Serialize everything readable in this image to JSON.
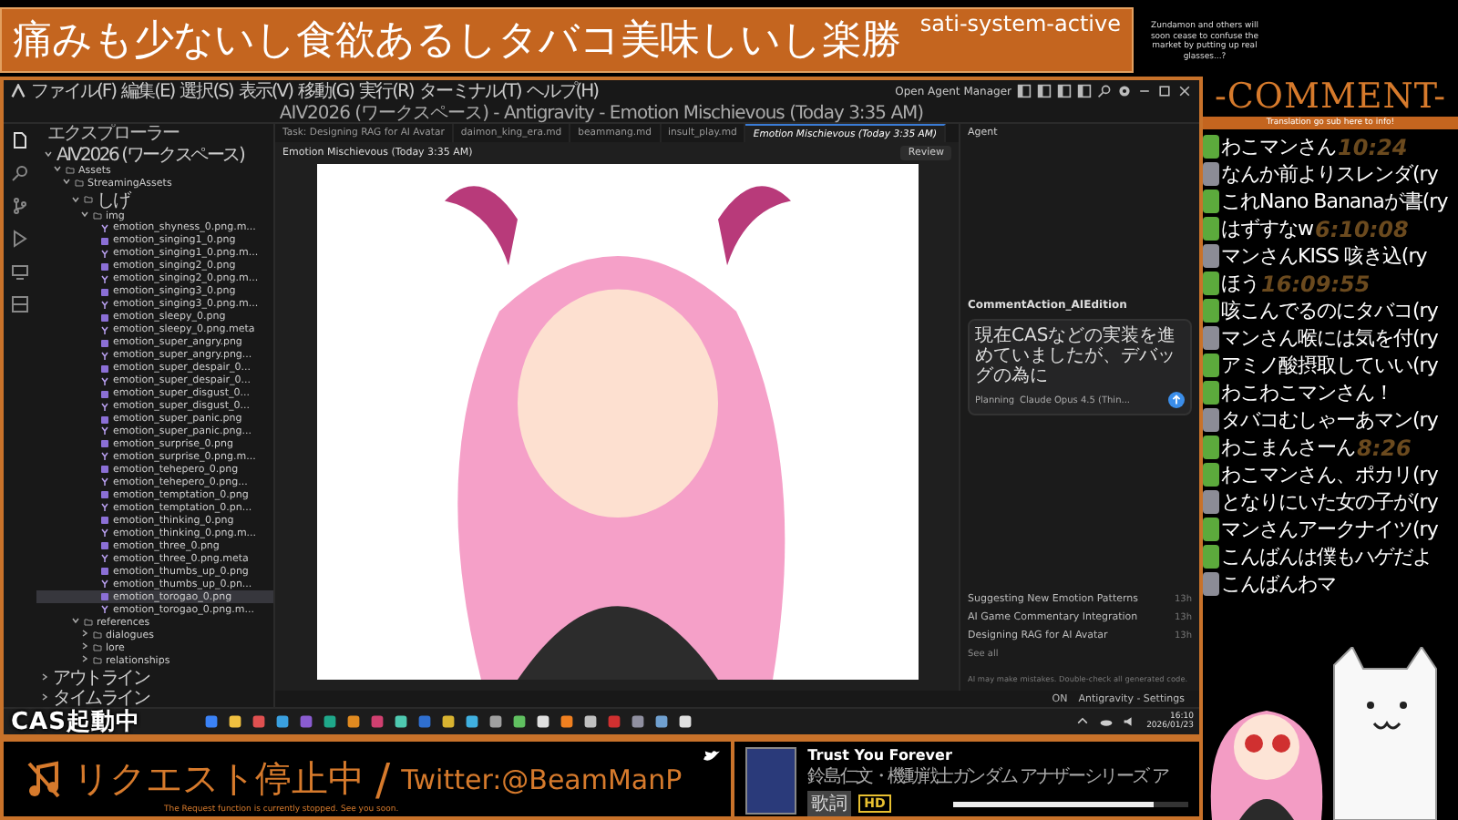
{
  "banner": {
    "title": "痛みも少ないし食欲あるしタバコ美味しいし楽勝",
    "status": "sati-system-active",
    "note": "Zundamon and others will soon cease to confuse the market by putting up real glasses...?"
  },
  "ide": {
    "menu": [
      "ファイル(F)",
      "編集(E)",
      "選択(S)",
      "表示(V)",
      "移動(G)",
      "実行(R)",
      "ターミナル(T)",
      "ヘルプ(H)"
    ],
    "window_title": "AIV2026 (ワークスペース) - Antigravity - Emotion Mischievous (Today 3:35 AM)",
    "agent_manager": "Open Agent Manager",
    "explorer": {
      "title": "エクスプローラー",
      "tree": [
        {
          "label": "AIV2026 (ワークスペース)",
          "expanded": true,
          "children": [
            {
              "label": "Assets",
              "expanded": true,
              "children": [
                {
                  "label": "StreamingAssets",
                  "expanded": true,
                  "children": [
                    {
                      "label": "しげ",
                      "expanded": true,
                      "children": [
                        {
                          "label": "img",
                          "expanded": true,
                          "children": [
                            {
                              "label": "emotion_shyness_0.png.m...",
                              "kind": "meta",
                              "selected": false
                            },
                            {
                              "label": "emotion_singing1_0.png",
                              "kind": "image",
                              "selected": false
                            },
                            {
                              "label": "emotion_singing1_0.png.m...",
                              "kind": "meta",
                              "selected": false
                            },
                            {
                              "label": "emotion_singing2_0.png",
                              "kind": "image",
                              "selected": false
                            },
                            {
                              "label": "emotion_singing2_0.png.m...",
                              "kind": "meta",
                              "selected": false
                            },
                            {
                              "label": "emotion_singing3_0.png",
                              "kind": "image",
                              "selected": false
                            },
                            {
                              "label": "emotion_singing3_0.png.m...",
                              "kind": "meta",
                              "selected": false
                            },
                            {
                              "label": "emotion_sleepy_0.png",
                              "kind": "image",
                              "selected": false
                            },
                            {
                              "label": "emotion_sleepy_0.png.meta",
                              "kind": "meta",
                              "selected": false
                            },
                            {
                              "label": "emotion_super_angry.png",
                              "kind": "image",
                              "selected": false
                            },
                            {
                              "label": "emotion_super_angry.png...",
                              "kind": "meta",
                              "selected": false
                            },
                            {
                              "label": "emotion_super_despair_0...",
                              "kind": "image",
                              "selected": false
                            },
                            {
                              "label": "emotion_super_despair_0...",
                              "kind": "meta",
                              "selected": false
                            },
                            {
                              "label": "emotion_super_disgust_0...",
                              "kind": "image",
                              "selected": false
                            },
                            {
                              "label": "emotion_super_disgust_0...",
                              "kind": "meta",
                              "selected": false
                            },
                            {
                              "label": "emotion_super_panic.png",
                              "kind": "image",
                              "selected": false
                            },
                            {
                              "label": "emotion_super_panic.png...",
                              "kind": "meta",
                              "selected": false
                            },
                            {
                              "label": "emotion_surprise_0.png",
                              "kind": "image",
                              "selected": false
                            },
                            {
                              "label": "emotion_surprise_0.png.m...",
                              "kind": "meta",
                              "selected": false
                            },
                            {
                              "label": "emotion_tehepero_0.png",
                              "kind": "image",
                              "selected": false
                            },
                            {
                              "label": "emotion_tehepero_0.png...",
                              "kind": "meta",
                              "selected": false
                            },
                            {
                              "label": "emotion_temptation_0.png",
                              "kind": "image",
                              "selected": false
                            },
                            {
                              "label": "emotion_temptation_0.pn...",
                              "kind": "meta",
                              "selected": false
                            },
                            {
                              "label": "emotion_thinking_0.png",
                              "kind": "image",
                              "selected": false
                            },
                            {
                              "label": "emotion_thinking_0.png.m...",
                              "kind": "meta",
                              "selected": false
                            },
                            {
                              "label": "emotion_three_0.png",
                              "kind": "image",
                              "selected": false
                            },
                            {
                              "label": "emotion_three_0.png.meta",
                              "kind": "meta",
                              "selected": false
                            },
                            {
                              "label": "emotion_thumbs_up_0.png",
                              "kind": "image",
                              "selected": false
                            },
                            {
                              "label": "emotion_thumbs_up_0.pn...",
                              "kind": "meta",
                              "selected": false
                            },
                            {
                              "label": "emotion_torogao_0.png",
                              "kind": "image",
                              "selected": true
                            },
                            {
                              "label": "emotion_torogao_0.png.m...",
                              "kind": "meta",
                              "selected": false
                            }
                          ]
                        }
                      ]
                    },
                    {
                      "label": "references",
                      "expanded": true,
                      "children": [
                        {
                          "label": "dialogues",
                          "expanded": false
                        },
                        {
                          "label": "lore",
                          "expanded": false
                        },
                        {
                          "label": "relationships",
                          "expanded": false
                        }
                      ]
                    }
                  ]
                }
              ]
            }
          ]
        }
      ],
      "sections": [
        {
          "label": "アウトライン",
          "expanded": false
        },
        {
          "label": "タイムライン",
          "expanded": false
        }
      ]
    },
    "tabs": [
      {
        "label": "Task: Designing RAG for AI Avatar",
        "selected": false
      },
      {
        "label": "daimon_king_era.md",
        "selected": false
      },
      {
        "label": "beammang.md",
        "selected": false
      },
      {
        "label": "insult_play.md",
        "selected": false
      },
      {
        "label": "Emotion Mischievous (Today 3:35 AM)",
        "selected": true
      }
    ],
    "editor": {
      "title": "Emotion Mischievous (Today 3:35 AM)",
      "review": "Review"
    },
    "agent": {
      "title": "Agent",
      "conversation": "CommentAction_AIEdition",
      "prompt": "現在CASなどの実装を進めていましたが、デバッグの為に",
      "mode": "Planning",
      "model": "Claude Opus 4.5 (Thin...",
      "history": [
        {
          "title": "Suggesting New Emotion Patterns",
          "age": "13h"
        },
        {
          "title": "AI Game Commentary Integration",
          "age": "13h"
        },
        {
          "title": "Designing RAG for AI Avatar",
          "age": "13h"
        }
      ],
      "see_all": "See all",
      "disclaimer": "AI may make mistakes. Double-check all generated code."
    },
    "status_bar": {
      "items": [
        "ON",
        "Antigravity - Settings"
      ]
    },
    "taskbar": {
      "overlay": "CAS起動中",
      "time": "16:10",
      "date": "2026/01/23"
    }
  },
  "comments": {
    "title": "-COMMENT-",
    "subtitle": "Translation go sub here to info!",
    "items": [
      {
        "text": "わこマンさん",
        "time": "10:24"
      },
      {
        "text": "なんか前よりスレンダ(ry"
      },
      {
        "text": "これNano Bananaが書(ry"
      },
      {
        "text": "はずすなw",
        "time": "6:10:08"
      },
      {
        "text": "マンさんKISS 咳き込(ry"
      },
      {
        "text": "ほう",
        "time": "16:09:55"
      },
      {
        "text": "咳こんでるのにタバコ(ry"
      },
      {
        "text": "マンさん喉には気を付(ry"
      },
      {
        "text": "アミノ酸摂取していい(ry"
      },
      {
        "text": "わこわこマンさん！"
      },
      {
        "text": "タバコむしゃーあマン(ry"
      },
      {
        "text": "わこまんさーん",
        "time": "8:26"
      },
      {
        "text": "わこマンさん、ポカリ(ry"
      },
      {
        "text": "となりにいた女の子が(ry"
      },
      {
        "text": "マンさんアークナイツ(ry"
      },
      {
        "text": "こんばんは僕もハゲだよ"
      },
      {
        "text": "こんばんわマ"
      }
    ]
  },
  "request_bar": {
    "status": "リクエスト停止中",
    "separator": "/",
    "twitter": "Twitter:@BeamManP",
    "notice": "The Request function is currently stopped. See you soon.",
    "song": {
      "title": "Trust You Forever",
      "artist": "鈴島仁文・機動戦士ガンダム アナザーシリーズ ア",
      "lyrics": "歌詞",
      "quality": "HD",
      "level": 0.85
    }
  }
}
